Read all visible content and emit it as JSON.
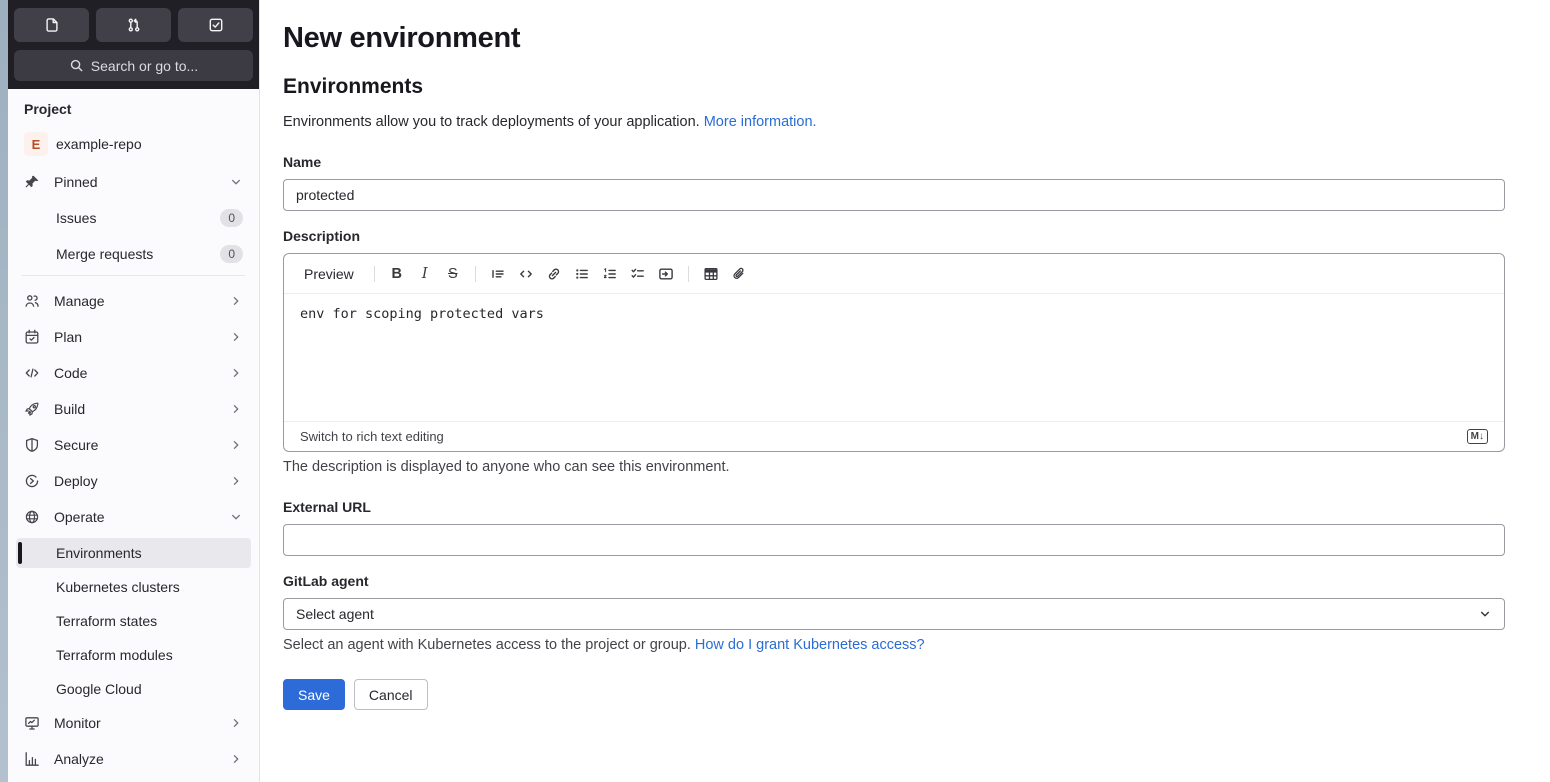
{
  "colors": {
    "accent_blue": "#2d6bd8",
    "link_blue": "#2a6cd4",
    "sidebar_dark": "#211f26",
    "active_item_bg": "#e9e8ec"
  },
  "sidebar": {
    "top_buttons": [
      {
        "icon": "issues-icon"
      },
      {
        "icon": "merge-request-icon"
      },
      {
        "icon": "todo-list-icon"
      }
    ],
    "search": {
      "label": "Search or go to...",
      "icon": "search-icon"
    },
    "section_label": "Project",
    "project": {
      "avatar_letter": "E",
      "name": "example-repo"
    },
    "pinned": {
      "label": "Pinned",
      "icon": "pin-icon"
    },
    "pinned_items": [
      {
        "label": "Issues",
        "count": "0"
      },
      {
        "label": "Merge requests",
        "count": "0"
      }
    ],
    "nav": [
      {
        "label": "Manage",
        "icon": "users-icon"
      },
      {
        "label": "Plan",
        "icon": "calendar-icon"
      },
      {
        "label": "Code",
        "icon": "code-icon"
      },
      {
        "label": "Build",
        "icon": "rocket-icon"
      },
      {
        "label": "Secure",
        "icon": "shield-icon"
      },
      {
        "label": "Deploy",
        "icon": "deploy-icon"
      },
      {
        "label": "Operate",
        "icon": "operate-icon"
      }
    ],
    "operate_children": [
      {
        "label": "Environments"
      },
      {
        "label": "Kubernetes clusters"
      },
      {
        "label": "Terraform states"
      },
      {
        "label": "Terraform modules"
      },
      {
        "label": "Google Cloud"
      }
    ],
    "nav_bottom": [
      {
        "label": "Monitor",
        "icon": "monitor-icon"
      },
      {
        "label": "Analyze",
        "icon": "chart-icon"
      }
    ]
  },
  "main": {
    "page_title": "New environment",
    "section_title": "Environments",
    "intro": {
      "text": "Environments allow you to track deployments of your application.",
      "link": "More information."
    },
    "name_field": {
      "label": "Name",
      "value": "protected"
    },
    "description_field": {
      "label": "Description",
      "preview_label": "Preview",
      "glyphs": {
        "bold": "B",
        "italic": "I",
        "strikethrough": "S"
      },
      "toolbar_icons": [
        "bold",
        "italic",
        "strikethrough",
        "quote",
        "code",
        "link",
        "bullet-list",
        "numbered-list",
        "task-list",
        "collapsible-section",
        "table",
        "attach-file"
      ],
      "value": "env for scoping protected vars",
      "switch_label": "Switch to rich text editing",
      "markdown_badge": "M↓",
      "help": "The description is displayed to anyone who can see this environment."
    },
    "external_url_field": {
      "label": "External URL",
      "value": ""
    },
    "agent_field": {
      "label": "GitLab agent",
      "value": "Select agent",
      "help_text": "Select an agent with Kubernetes access to the project or group.",
      "help_link": "How do I grant Kubernetes access?"
    },
    "actions": {
      "save_label": "Save",
      "cancel_label": "Cancel"
    }
  }
}
